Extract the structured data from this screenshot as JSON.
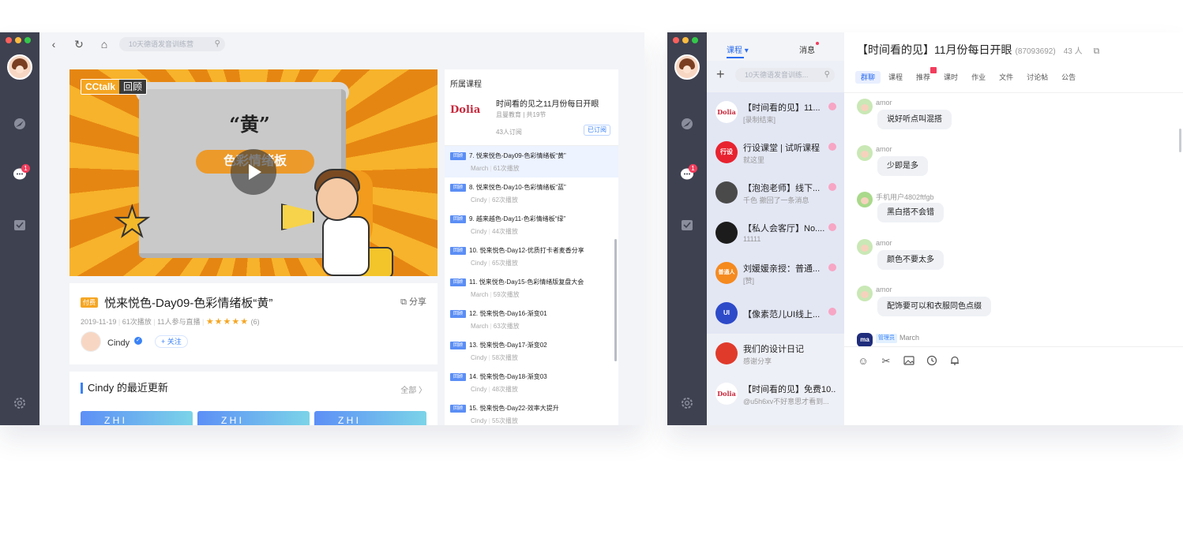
{
  "window1": {
    "sidebar": {
      "icons": [
        "avatar",
        "compass-icon",
        "chat-icon",
        "calendar-icon",
        "gear-icon"
      ],
      "chat_badge": "1"
    },
    "toolbar": {
      "search_placeholder": "10天德语发音训练营"
    },
    "video": {
      "tag_brand": "CCtalk",
      "tag_replay": "回顾",
      "overlay_title": "“黄”",
      "overlay_banner": "色彩情绪板"
    },
    "course": {
      "paid_tag": "付费",
      "title": "悦来悦色-Day09-色彩情绪板“黄”",
      "share": "分享",
      "date": "2019-11-19",
      "plays": "61次播放",
      "live": "11人参与直播",
      "stars": "★★★★★",
      "rating_count": "(6)",
      "teacher": "Cindy",
      "follow": "+ 关注"
    },
    "updates": {
      "title": "Cindy 的最近更新",
      "all": "全部 〉",
      "thumb_text": "Z H I"
    },
    "panel": {
      "header": "所属课程",
      "logo": "Dolia",
      "course_name": "时间看的见之11月份每日开眼",
      "meta": "且曼教育 | 共19节",
      "subscribers": "43人订阅",
      "subscribed": "已订阅",
      "lesson_tag": "回顾",
      "lessons": [
        {
          "title": "7. 悦来悦色-Day09-色彩情绪板“黄”",
          "teacher": "March",
          "plays": "61次播放"
        },
        {
          "title": "8. 悦来悦色-Day10-色彩情绪板“蓝”",
          "teacher": "Cindy",
          "plays": "62次播放"
        },
        {
          "title": "9. 越来越色-Day11-色彩情绪板“绿”",
          "teacher": "Cindy",
          "plays": "44次播放"
        },
        {
          "title": "10. 悦来悦色-Day12-优质打卡者麦香分享",
          "teacher": "Cindy",
          "plays": "65次播放"
        },
        {
          "title": "11. 悦来悦色-Day15-色彩情绪版复盘大会",
          "teacher": "March",
          "plays": "59次播放"
        },
        {
          "title": "12. 悦来悦色-Day16-渐变01",
          "teacher": "March",
          "plays": "63次播放"
        },
        {
          "title": "13. 悦来悦色-Day17-渐变02",
          "teacher": "Cindy",
          "plays": "58次播放"
        },
        {
          "title": "14. 悦来悦色-Day18-渐变03",
          "teacher": "Cindy",
          "plays": "48次播放"
        },
        {
          "title": "15. 悦来悦色-Day22-效率大提升",
          "teacher": "Cindy",
          "plays": "55次播放"
        }
      ]
    }
  },
  "window2": {
    "sidebar": {
      "chat_badge": "1"
    },
    "list": {
      "tab_courses": "课程 ▾",
      "tab_messages": "消息",
      "search_placeholder": "10天德语发音训练...",
      "conversations": [
        {
          "name": "【时间看的见】11...",
          "sub": "[录制结束]",
          "avatar_text": "Dolia",
          "color": "#ffffff"
        },
        {
          "name": "行设课堂 | 试听课程",
          "sub": "就这里",
          "avatar_text": "行设",
          "color": "#e8232f"
        },
        {
          "name": "【泡泡老师】线下...",
          "sub": "千色 撤回了一条消息",
          "avatar_text": "",
          "color": "#4a4a4a"
        },
        {
          "name": "【私人会客厅】No....",
          "sub": "11111",
          "avatar_text": "",
          "color": "#1c1c1c"
        },
        {
          "name": "刘媛媛亲授：普通...",
          "sub": "[赞]",
          "avatar_text": "普通人",
          "color": "#f58a1f"
        },
        {
          "name": "【像素范儿UI线上...",
          "sub": "",
          "avatar_text": "UI",
          "color": "#2d4ac9"
        },
        {
          "name": "我们的设计日记",
          "sub": "感谢分享",
          "avatar_text": "",
          "color": "#e03a2b"
        },
        {
          "name": "【时间看的见】免费10...",
          "sub": "@u5h6xv不好意思才看到...",
          "avatar_text": "Dolia",
          "color": "#ffffff"
        }
      ]
    },
    "chat": {
      "title": "【时间看的见】11月份每日开眼",
      "group_id": "(87093692)",
      "member_count": "43 人",
      "tabs": [
        "群聊",
        "课程",
        "推荐",
        "课时",
        "作业",
        "文件",
        "讨论帖",
        "公告"
      ],
      "messages": [
        {
          "user": "amor",
          "text": "说好听点叫混搭"
        },
        {
          "user": "amor",
          "text": "少即是多"
        },
        {
          "user": "手机用户4802ftfgb",
          "text": "黑白搭不会错"
        },
        {
          "user": "amor",
          "text": "颜色不要太多"
        },
        {
          "user": "amor",
          "text": "配饰要可以和衣服同色点缀"
        }
      ],
      "last": {
        "avatar": "ma",
        "role": "管理员",
        "user": "March"
      },
      "tools": [
        "emoji-icon",
        "scissors-icon",
        "image-icon",
        "clock-icon",
        "bell-icon"
      ]
    }
  }
}
